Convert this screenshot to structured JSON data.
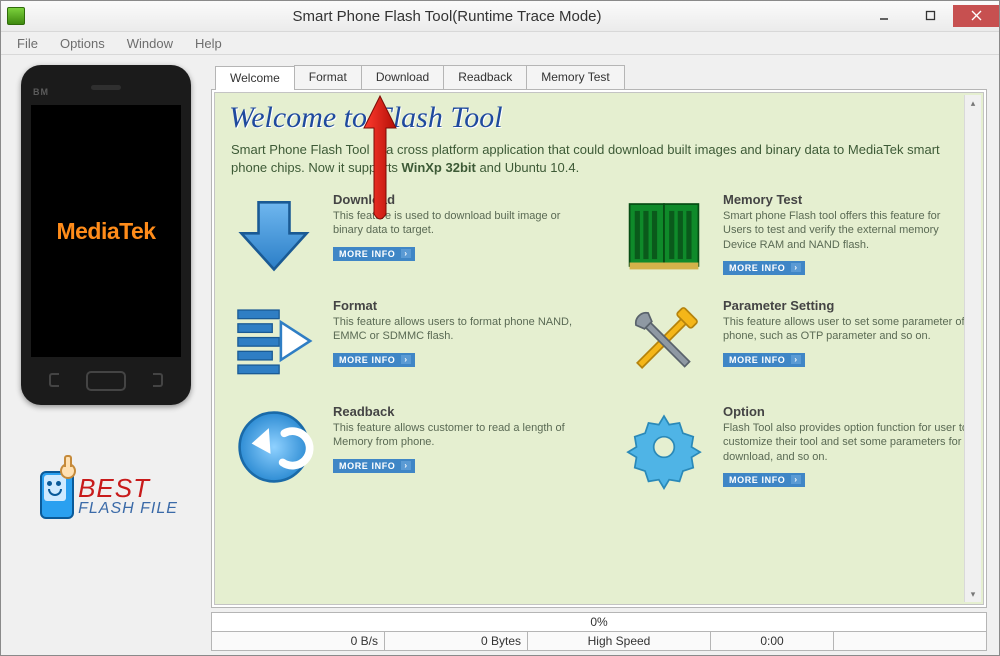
{
  "window": {
    "title": "Smart Phone Flash Tool(Runtime Trace Mode)"
  },
  "menu": {
    "file": "File",
    "options": "Options",
    "window": "Window",
    "help": "Help"
  },
  "phone": {
    "brand": "BM",
    "screen_text": "MediaTek"
  },
  "bff": {
    "line1": "BEST",
    "line2": "FLASH FILE"
  },
  "tabs": {
    "welcome": "Welcome",
    "format": "Format",
    "download": "Download",
    "readback": "Readback",
    "memtest": "Memory Test"
  },
  "welcome": {
    "title": "Welcome to Flash Tool",
    "desc_pre": "Smart Phone Flash Tool is a cross platform application that could download built images and binary data to MediaTek smart phone chips. Now it supports ",
    "desc_bold1": "WinXp 32bit",
    "desc_mid": " and Ubuntu 10.4."
  },
  "feat": {
    "download": {
      "title": "Download",
      "desc": "This feature is used to download built image or binary data to target."
    },
    "memtest": {
      "title": "Memory Test",
      "desc": "Smart phone Flash tool offers this feature for Users to test and verify the external memory Device RAM and NAND flash."
    },
    "format": {
      "title": "Format",
      "desc": "This feature allows users to format phone NAND, EMMC or SDMMC flash."
    },
    "param": {
      "title": "Parameter Setting",
      "desc": "This feature allows user to set some parameter of phone, such as OTP parameter and so on."
    },
    "readback": {
      "title": "Readback",
      "desc": "This feature allows customer to read a length of\nMemory from phone."
    },
    "option": {
      "title": "Option",
      "desc": "  Flash Tool also provides option function for user to customize their tool and set some parameters for download, and so on."
    }
  },
  "more_label": "MORE INFO",
  "status": {
    "progress": "0%",
    "rate": "0 B/s",
    "bytes": "0 Bytes",
    "mode": "High Speed",
    "time": "0:00"
  }
}
